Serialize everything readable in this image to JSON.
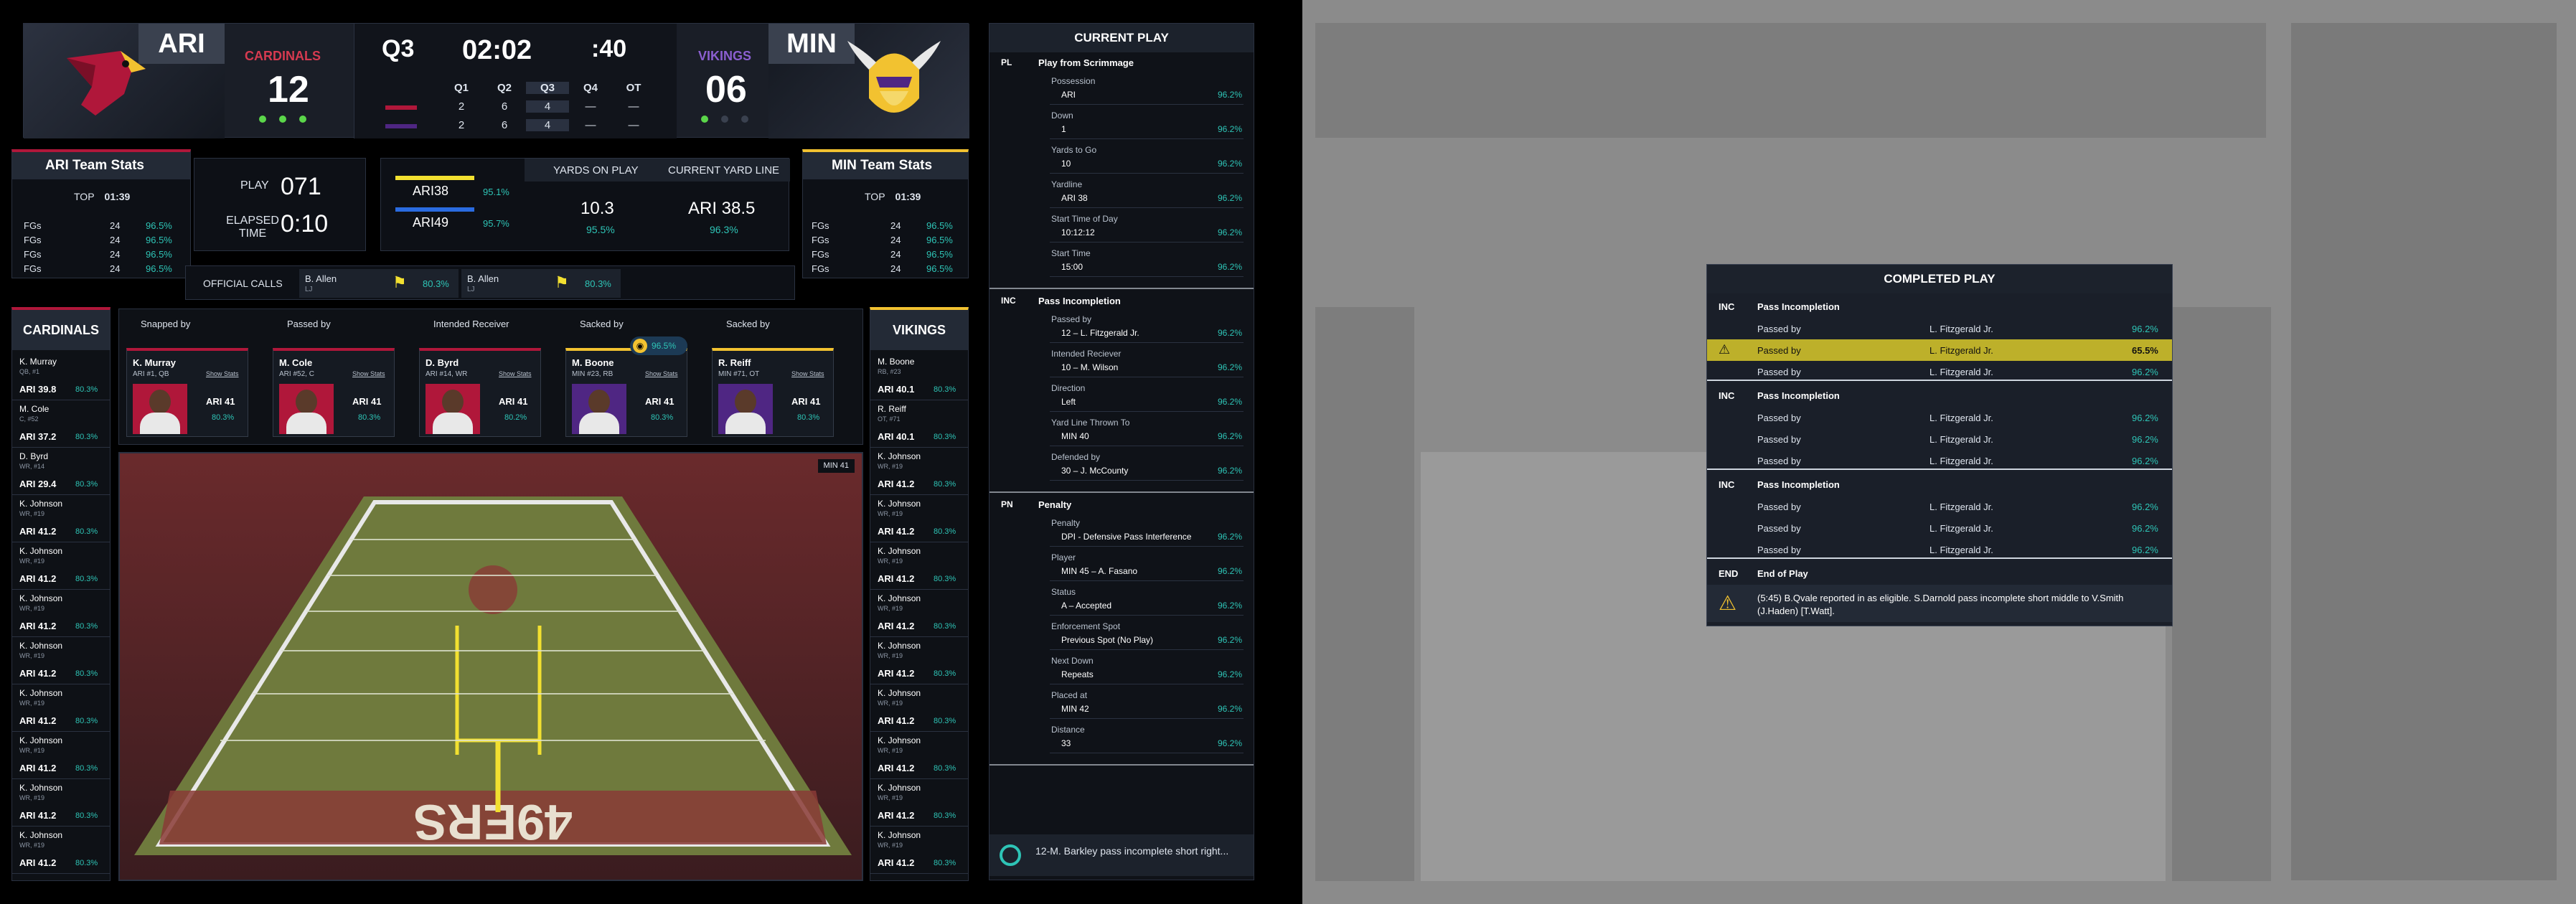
{
  "scoreboard": {
    "home": {
      "abbr": "ARI",
      "name": "CARDINALS",
      "score": "12"
    },
    "away": {
      "abbr": "MIN",
      "name": "VIKINGS",
      "score": "06"
    },
    "quarter": "Q3",
    "clock": "02:02",
    "play_clock": ":40",
    "quarter_headers": [
      "Q1",
      "Q2",
      "Q3",
      "Q4",
      "OT"
    ],
    "home_quarters": [
      "2",
      "6",
      "4",
      "—",
      "—"
    ],
    "away_quarters": [
      "2",
      "6",
      "4",
      "—",
      "—"
    ]
  },
  "ari_stats": {
    "title": "ARI Team Stats",
    "top_label": "TOP",
    "top_value": "01:39",
    "rows": [
      [
        "FGs",
        "24",
        "96.5%"
      ],
      [
        "FGs",
        "24",
        "96.5%"
      ],
      [
        "FGs",
        "24",
        "96.5%"
      ],
      [
        "FGs",
        "24",
        "96.5%"
      ]
    ]
  },
  "min_stats": {
    "title": "MIN Team Stats",
    "top_label": "TOP",
    "top_value": "01:39",
    "rows": [
      [
        "FGs",
        "24",
        "96.5%"
      ],
      [
        "FGs",
        "24",
        "96.5%"
      ],
      [
        "FGs",
        "24",
        "96.5%"
      ],
      [
        "FGs",
        "24",
        "96.5%"
      ]
    ]
  },
  "play_info": {
    "play_label": "PLAY",
    "play_value": "071",
    "elapsed_label": "ELAPSED TIME",
    "elapsed_value": "0:10",
    "ari_yard": "ARI38",
    "ari_yard_pct": "95.1%",
    "ari_yard2": "ARI49",
    "ari_yard2_pct": "95.7%",
    "yop_label": "YARDS ON PLAY",
    "yop_value": "10.3",
    "yop_pct": "95.5%",
    "cyl_label": "CURRENT YARD LINE",
    "cyl_value": "ARI 38.5",
    "cyl_pct": "96.3%"
  },
  "official_calls": {
    "label": "OFFICIAL CALLS",
    "calls": [
      {
        "name": "B. Allen",
        "pos": "LJ",
        "pct": "80.3%"
      },
      {
        "name": "B. Allen",
        "pos": "LJ",
        "pct": "80.3%"
      }
    ]
  },
  "roster_left": {
    "title": "CARDINALS",
    "players": [
      {
        "name": "K. Murray",
        "pos": "QB, #1",
        "yard": "ARI 39.8",
        "pct": "80.3%"
      },
      {
        "name": "M. Cole",
        "pos": "C, #52",
        "yard": "ARI 37.2",
        "pct": "80.3%"
      },
      {
        "name": "D. Byrd",
        "pos": "WR, #14",
        "yard": "ARI 29.4",
        "pct": "80.3%"
      },
      {
        "name": "K. Johnson",
        "pos": "WR, #19",
        "yard": "ARI 41.2",
        "pct": "80.3%"
      },
      {
        "name": "K. Johnson",
        "pos": "WR, #19",
        "yard": "ARI 41.2",
        "pct": "80.3%"
      },
      {
        "name": "K. Johnson",
        "pos": "WR, #19",
        "yard": "ARI 41.2",
        "pct": "80.3%"
      },
      {
        "name": "K. Johnson",
        "pos": "WR, #19",
        "yard": "ARI 41.2",
        "pct": "80.3%"
      },
      {
        "name": "K. Johnson",
        "pos": "WR, #19",
        "yard": "ARI 41.2",
        "pct": "80.3%"
      },
      {
        "name": "K. Johnson",
        "pos": "WR, #19",
        "yard": "ARI 41.2",
        "pct": "80.3%"
      },
      {
        "name": "K. Johnson",
        "pos": "WR, #19",
        "yard": "ARI 41.2",
        "pct": "80.3%"
      },
      {
        "name": "K. Johnson",
        "pos": "WR, #19",
        "yard": "ARI 41.2",
        "pct": "80.3%"
      }
    ]
  },
  "roster_right": {
    "title": "VIKINGS",
    "players": [
      {
        "name": "M. Boone",
        "pos": "RB, #23",
        "yard": "ARI 40.1",
        "pct": "80.3%"
      },
      {
        "name": "R. Reiff",
        "pos": "OT, #71",
        "yard": "ARI 40.1",
        "pct": "80.3%"
      },
      {
        "name": "K. Johnson",
        "pos": "WR, #19",
        "yard": "ARI 41.2",
        "pct": "80.3%"
      },
      {
        "name": "K. Johnson",
        "pos": "WR, #19",
        "yard": "ARI 41.2",
        "pct": "80.3%"
      },
      {
        "name": "K. Johnson",
        "pos": "WR, #19",
        "yard": "ARI 41.2",
        "pct": "80.3%"
      },
      {
        "name": "K. Johnson",
        "pos": "WR, #19",
        "yard": "ARI 41.2",
        "pct": "80.3%"
      },
      {
        "name": "K. Johnson",
        "pos": "WR, #19",
        "yard": "ARI 41.2",
        "pct": "80.3%"
      },
      {
        "name": "K. Johnson",
        "pos": "WR, #19",
        "yard": "ARI 41.2",
        "pct": "80.3%"
      },
      {
        "name": "K. Johnson",
        "pos": "WR, #19",
        "yard": "ARI 41.2",
        "pct": "80.3%"
      },
      {
        "name": "K. Johnson",
        "pos": "WR, #19",
        "yard": "ARI 41.2",
        "pct": "80.3%"
      },
      {
        "name": "K. Johnson",
        "pos": "WR, #19",
        "yard": "ARI 41.2",
        "pct": "80.3%"
      }
    ]
  },
  "cards": [
    {
      "role": "Snapped by",
      "name": "K. Murray",
      "pos": "ARI #1, QB",
      "yard": "ARI 41",
      "pct": "80.3%",
      "link": "Show Stats"
    },
    {
      "role": "Passed by",
      "name": "M. Cole",
      "pos": "ARI #52, C",
      "yard": "ARI 41",
      "pct": "80.3%",
      "link": "Show Stats"
    },
    {
      "role": "Intended Receiver",
      "name": "D. Byrd",
      "pos": "ARI #14, WR",
      "yard": "ARI 41",
      "pct": "80.2%",
      "link": "Show Stats"
    },
    {
      "role": "Sacked by",
      "name": "M. Boone",
      "pos": "MIN #23, RB",
      "yard": "ARI 41",
      "pct": "80.3%",
      "link": "Show Stats",
      "badge": "96.5%"
    },
    {
      "role": "Sacked by",
      "name": "R. Reiff",
      "pos": "MIN #71, OT",
      "yard": "ARI 41",
      "pct": "80.3%",
      "link": "Show Stats"
    }
  ],
  "field_tag": "MIN 41",
  "current_play": {
    "title": "CURRENT PLAY",
    "sections": [
      {
        "code": "PL",
        "title": "Play from Scrimmage",
        "items": [
          {
            "label": "Possession",
            "value": "ARI",
            "pct": "96.2%"
          },
          {
            "label": "Down",
            "value": "1",
            "pct": "96.2%"
          },
          {
            "label": "Yards to Go",
            "value": "10",
            "pct": "96.2%"
          },
          {
            "label": "Yardline",
            "value": "ARI 38",
            "pct": "96.2%"
          },
          {
            "label": "Start Time of Day",
            "value": "10:12:12",
            "pct": "96.2%"
          },
          {
            "label": "Start Time",
            "value": "15:00",
            "pct": "96.2%"
          }
        ]
      },
      {
        "code": "INC",
        "title": "Pass Incompletion",
        "items": [
          {
            "label": "Passed by",
            "value": "12 – L. Fitzgerald Jr.",
            "pct": "96.2%"
          },
          {
            "label": "Intended Reciever",
            "value": "10 – M. Wilson",
            "pct": "96.2%"
          },
          {
            "label": "Direction",
            "value": "Left",
            "pct": "96.2%"
          },
          {
            "label": "Yard Line Thrown To",
            "value": "MIN 40",
            "pct": "96.2%"
          },
          {
            "label": "Defended by",
            "value": "30 – J. McCounty",
            "pct": "96.2%"
          }
        ]
      },
      {
        "code": "PN",
        "title": "Penalty",
        "items": [
          {
            "label": "Penalty",
            "value": "DPI - Defensive Pass Interference",
            "pct": "96.2%"
          },
          {
            "label": "Player",
            "value": "MIN 45 – A. Fasano",
            "pct": "96.2%"
          },
          {
            "label": "Status",
            "value": "A – Accepted",
            "pct": "96.2%"
          },
          {
            "label": "Enforcement Spot",
            "value": "Previous Spot (No Play)",
            "pct": "96.2%"
          },
          {
            "label": "Next Down",
            "value": "Repeats",
            "pct": "96.2%"
          },
          {
            "label": "Placed at",
            "value": "MIN 42",
            "pct": "96.2%"
          },
          {
            "label": "Distance",
            "value": "33",
            "pct": "96.2%"
          }
        ]
      }
    ],
    "ticker": "12-M. Barkley pass incomplete short right..."
  },
  "completed_play": {
    "title": "COMPLETED PLAY",
    "groups": [
      {
        "code": "INC",
        "title": "Pass Incompletion",
        "rows": [
          {
            "label": "Passed by",
            "value": "L. Fitzgerald Jr.",
            "pct": "96.2%",
            "warn": false
          },
          {
            "label": "Passed by",
            "value": "L. Fitzgerald Jr.",
            "pct": "65.5%",
            "warn": true
          },
          {
            "label": "Passed by",
            "value": "L. Fitzgerald Jr.",
            "pct": "96.2%",
            "warn": false
          }
        ]
      },
      {
        "code": "INC",
        "title": "Pass Incompletion",
        "rows": [
          {
            "label": "Passed by",
            "value": "L. Fitzgerald Jr.",
            "pct": "96.2%",
            "warn": false
          },
          {
            "label": "Passed by",
            "value": "L. Fitzgerald Jr.",
            "pct": "96.2%",
            "warn": false
          },
          {
            "label": "Passed by",
            "value": "L. Fitzgerald Jr.",
            "pct": "96.2%",
            "warn": false
          }
        ]
      },
      {
        "code": "INC",
        "title": "Pass Incompletion",
        "rows": [
          {
            "label": "Passed by",
            "value": "L. Fitzgerald Jr.",
            "pct": "96.2%",
            "warn": false
          },
          {
            "label": "Passed by",
            "value": "L. Fitzgerald Jr.",
            "pct": "96.2%",
            "warn": false
          },
          {
            "label": "Passed by",
            "value": "L. Fitzgerald Jr.",
            "pct": "96.2%",
            "warn": false
          }
        ]
      }
    ],
    "end_code": "END",
    "end_title": "End of Play",
    "note": "(5:45) B.Qvale reported in as eligible. S.Darnold pass incomplete short middle to V.Smith (J.Haden) [T.Watt]."
  },
  "colors": {
    "ari": "#b0173a",
    "min": "#4f2683",
    "gold": "#f2c230",
    "teal": "#2ec4b6",
    "bg": "#000000"
  }
}
